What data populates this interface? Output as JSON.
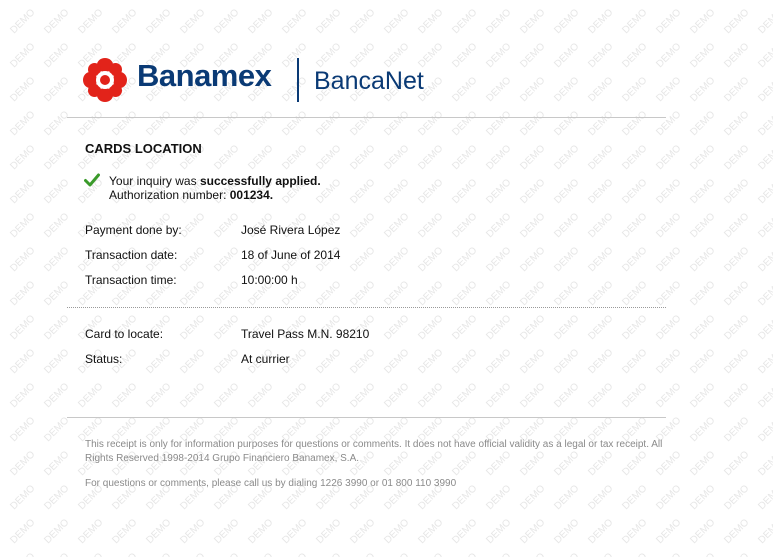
{
  "header": {
    "brand": "Banamex",
    "product": "BancaNet"
  },
  "watermark": {
    "text": "DEMO"
  },
  "page": {
    "title": "CARDS LOCATION"
  },
  "confirmation": {
    "line1_prefix": "Your inquiry was ",
    "line1_bold": "successfully applied.",
    "line2_prefix": "Authorization number: ",
    "line2_bold": "001234."
  },
  "details": {
    "payment_by_label": "Payment done by:",
    "payment_by_value": "José Rivera López",
    "date_label": "Transaction date:",
    "date_value": "18 of June of 2014",
    "time_label": "Transaction time:",
    "time_value": "10:00:00 h",
    "card_label": "Card to locate:",
    "card_value": "Travel Pass M.N. 98210",
    "status_label": "Status:",
    "status_value": "At currier"
  },
  "footer": {
    "disclaimer": "This receipt is only for information purposes for questions or comments. It does not have official validity as a legal or tax receipt. All Rights Reserved 1998-2014 Grupo Financiero Banamex, S.A.",
    "contact": "For questions or comments, please call us by dialing 1226 3990 or 01 800 110 3990"
  },
  "colors": {
    "brand_blue": "#0a3a75",
    "brand_red": "#e2231a",
    "success_green": "#3a9a2a",
    "watermark_gray": "#e6e6e6"
  }
}
